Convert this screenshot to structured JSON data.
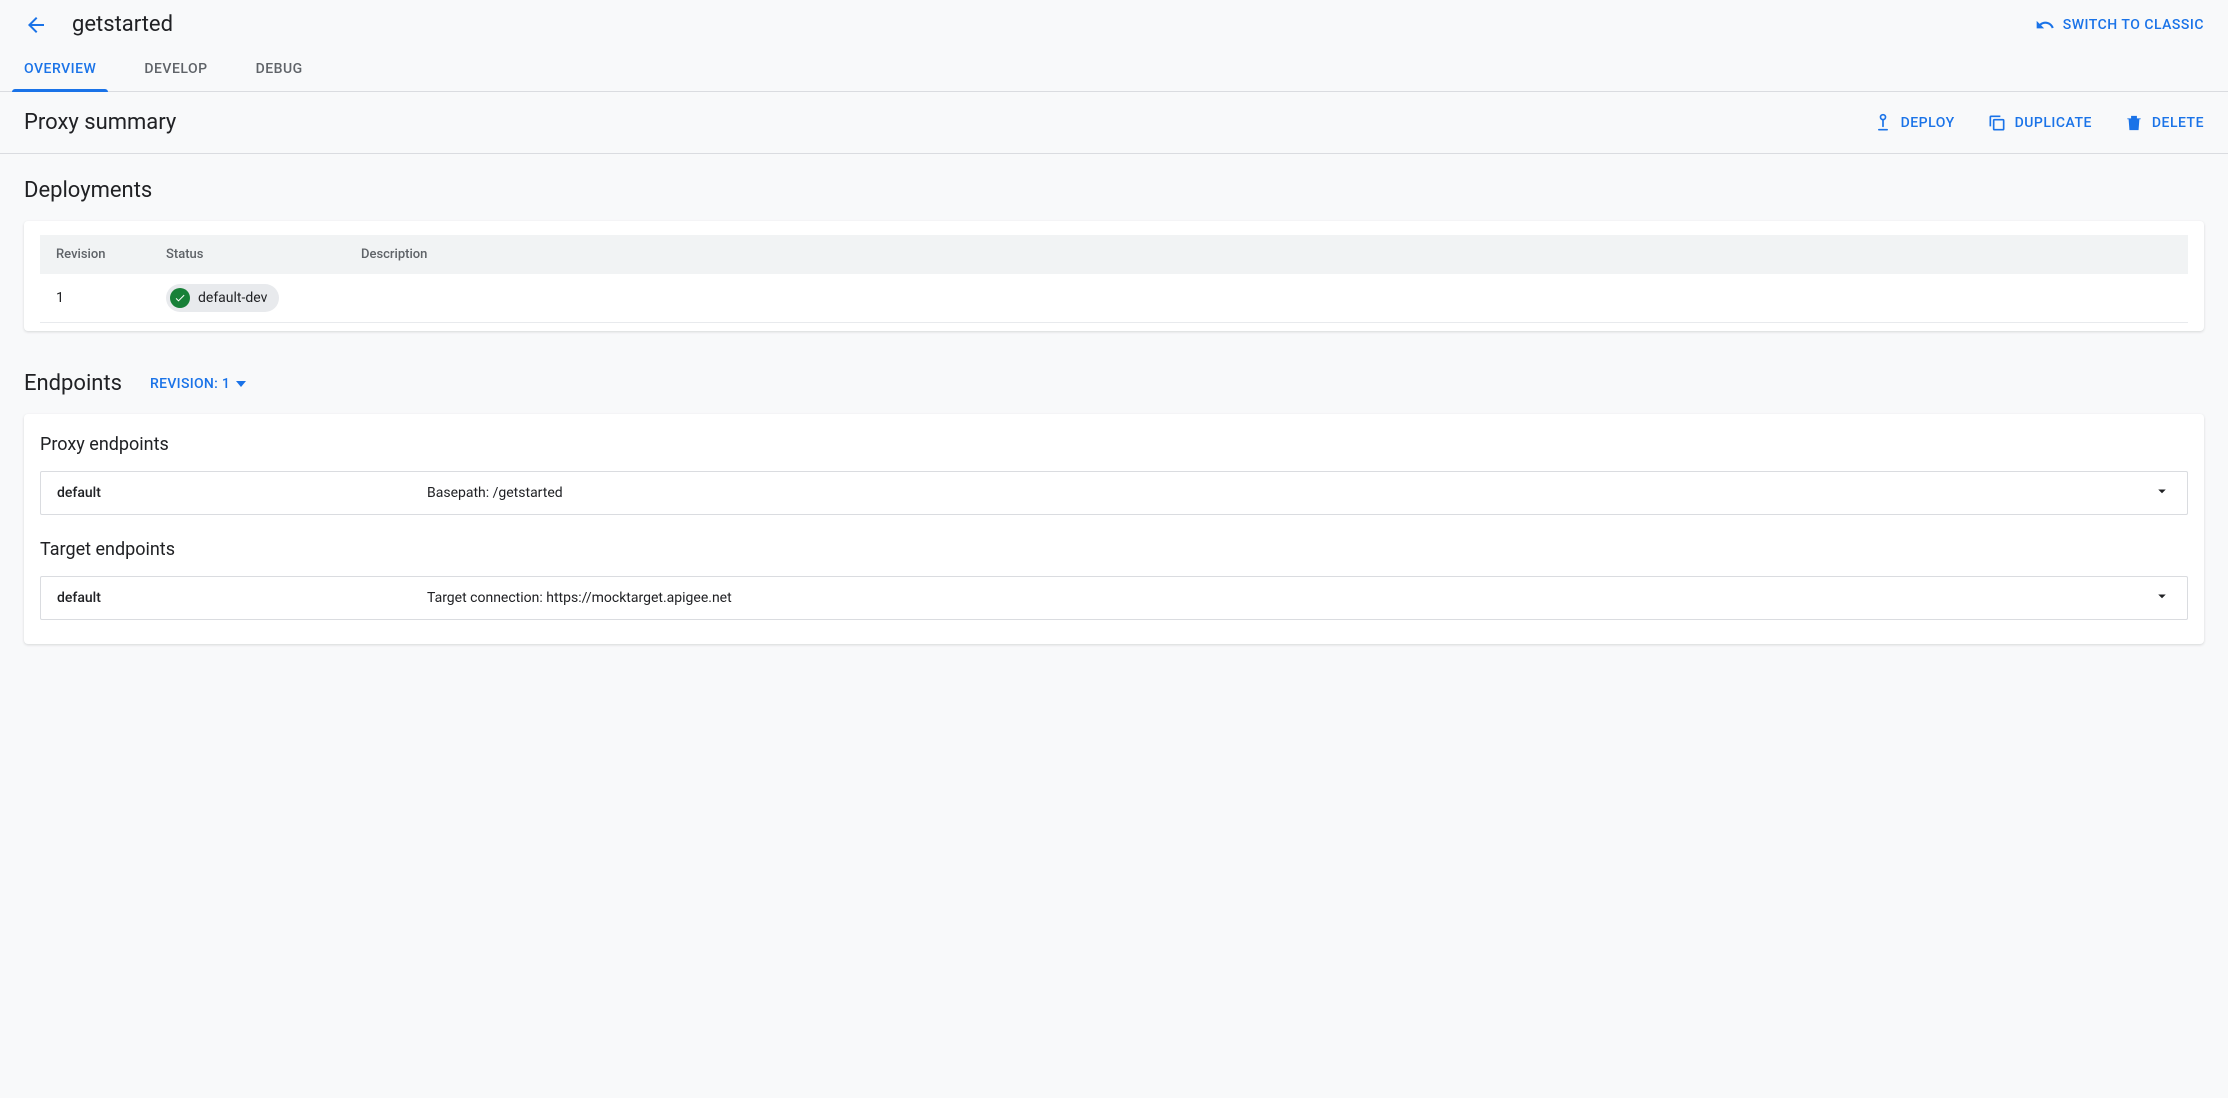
{
  "header": {
    "title": "getstarted",
    "switch_label": "SWITCH TO CLASSIC"
  },
  "tabs": {
    "overview": "OVERVIEW",
    "develop": "DEVELOP",
    "debug": "DEBUG"
  },
  "summary": {
    "title": "Proxy summary",
    "actions": {
      "deploy": "DEPLOY",
      "duplicate": "DUPLICATE",
      "delete": "DELETE"
    }
  },
  "deployments": {
    "title": "Deployments",
    "columns": {
      "revision": "Revision",
      "status": "Status",
      "description": "Description"
    },
    "rows": [
      {
        "revision": "1",
        "status": "default-dev",
        "description": ""
      }
    ]
  },
  "endpoints": {
    "title": "Endpoints",
    "revision_label": "REVISION: 1",
    "proxy_title": "Proxy endpoints",
    "proxy_rows": [
      {
        "name": "default",
        "detail": "Basepath: /getstarted"
      }
    ],
    "target_title": "Target endpoints",
    "target_rows": [
      {
        "name": "default",
        "detail": "Target connection: https://mocktarget.apigee.net"
      }
    ]
  }
}
